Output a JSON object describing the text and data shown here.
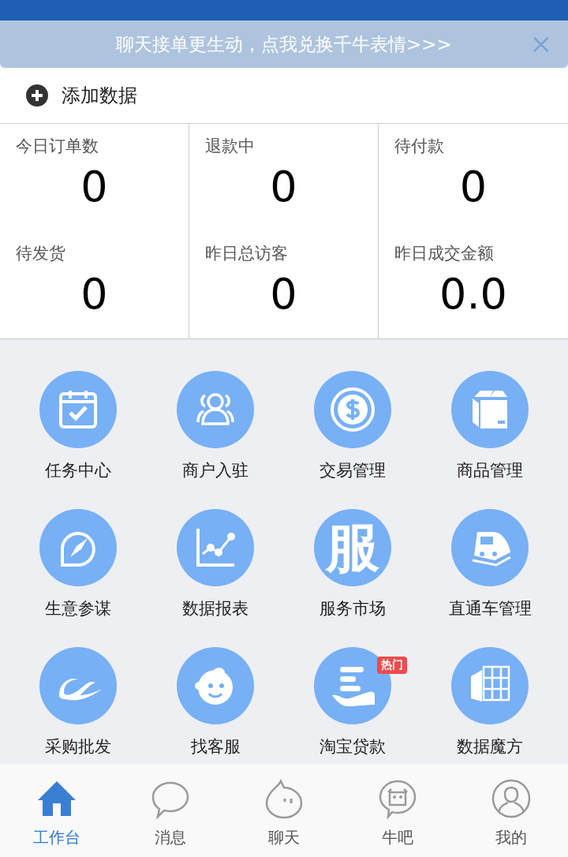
{
  "banner": {
    "text": "聊天接单更生动，点我兑换千牛表情>>>",
    "close": "×"
  },
  "add_data": {
    "label": "添加数据"
  },
  "stats": [
    {
      "label": "今日订单数",
      "value": "0"
    },
    {
      "label": "退款中",
      "value": "0"
    },
    {
      "label": "待付款",
      "value": "0"
    },
    {
      "label": "待发货",
      "value": "0"
    },
    {
      "label": "昨日总访客",
      "value": "0"
    },
    {
      "label": "昨日成交金额",
      "value": "0.0"
    }
  ],
  "tiles": [
    {
      "kind": "calendar",
      "label": "任务中心"
    },
    {
      "kind": "people",
      "label": "商户入驻"
    },
    {
      "kind": "dollar",
      "label": "交易管理"
    },
    {
      "kind": "box",
      "label": "商品管理"
    },
    {
      "kind": "compass",
      "label": "生意参谋"
    },
    {
      "kind": "chart",
      "label": "数据报表"
    },
    {
      "kind": "glyph",
      "glyph": "服",
      "label": "服务市场"
    },
    {
      "kind": "train",
      "label": "直通车管理"
    },
    {
      "kind": "swoosh",
      "label": "采购批发"
    },
    {
      "kind": "mascot",
      "label": "找客服"
    },
    {
      "kind": "hand",
      "label": "淘宝贷款",
      "badge": "热门"
    },
    {
      "kind": "building",
      "label": "数据魔方"
    }
  ],
  "tabs": [
    {
      "kind": "home",
      "label": "工作台",
      "selected": true
    },
    {
      "kind": "bubble",
      "label": "消息",
      "selected": false
    },
    {
      "kind": "drop",
      "label": "聊天",
      "selected": false
    },
    {
      "kind": "cow",
      "label": "牛吧",
      "selected": false
    },
    {
      "kind": "person",
      "label": "我的",
      "selected": false
    }
  ]
}
